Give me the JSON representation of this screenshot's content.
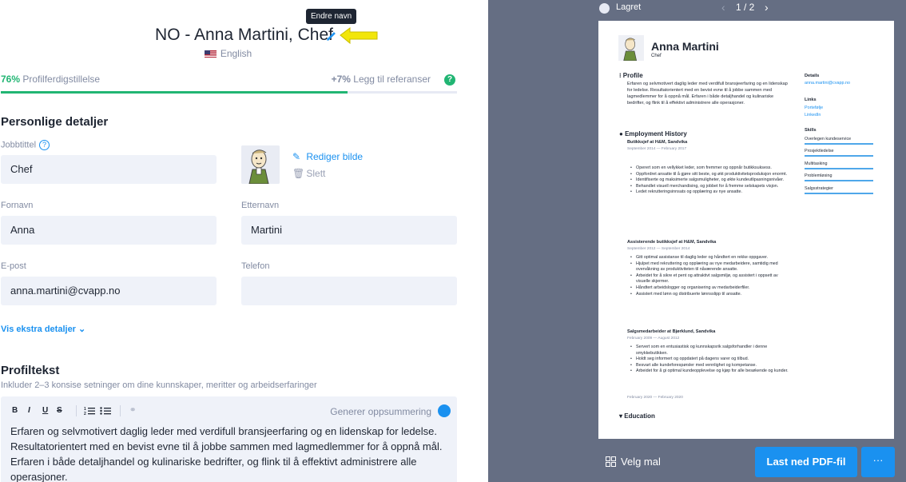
{
  "header": {
    "title": "NO - Anna Martini, Chef",
    "tooltip": "Endre navn",
    "language": "English"
  },
  "progress": {
    "percent_label": "76%",
    "label": "Profilferdigstillelse",
    "bonus": "+7%",
    "bonus_label": "Legg til referanser",
    "help": "?",
    "fill": 0.76
  },
  "personal": {
    "section_title": "Personlige detaljer",
    "job_title_label": "Jobbtittel",
    "job_title_value": "Chef",
    "edit_photo": "Rediger bilde",
    "delete_photo": "Slett",
    "first_name_label": "Fornavn",
    "first_name_value": "Anna",
    "last_name_label": "Etternavn",
    "last_name_value": "Martini",
    "email_label": "E-post",
    "email_value": "anna.martini@cvapp.no",
    "phone_label": "Telefon",
    "phone_value": "",
    "extra_details": "Vis ekstra detaljer"
  },
  "profile": {
    "section_title": "Profiltekst",
    "hint": "Inkluder 2–3 konsise setninger om dine kunnskaper, meritter og arbeidserfaringer",
    "toolbar": {
      "bold": "B",
      "italic": "I",
      "underline": "U",
      "strike": "S"
    },
    "generate": "Generer oppsummering",
    "text": " Erfaren og selvmotivert daglig leder med verdifull bransjeerfaring og en lidenskap for ledelse. Resultatorientert med en bevist evne til å jobbe sammen med lagmedlemmer for å oppnå mål. Erfaren i både detaljhandel og kulinariske bedrifter, og flink til å effektivt administrere alle operasjoner."
  },
  "preview": {
    "saved": "Lagret",
    "page_indicator": "1 / 2",
    "choose_template": "Velg mal",
    "download": "Last ned PDF-fil",
    "more": "···",
    "cv": {
      "name": "Anna Martini",
      "role": "Chef",
      "profile_h": "Profile",
      "profile_text": " Erfaren og selvmotivert daglig leder med verdifull bransjeerfaring og en lidenskap for ledelse.  Resultatorientert med en bevist evne til å jobbe sammen med lagmedlemmer for å oppnå mål.  Erfaren i både detaljhandel og kulinariske bedrifter, og flink til å effektivt administrere alle operasjoner.",
      "employment_h": "Employment History",
      "job1_title": "Butikksjef at H&M, Sandvika",
      "job1_date": "September 2014 — February 2017",
      "job1_items": [
        "Operert som en vellykket leder, som fremmer og oppnår butikksuksess.",
        "Oppfordret ansatte til å gjøre sitt beste, og økt produktivitetsproduksjon enormt.",
        "Identifiserte og maksimerte salgsmuligheter, og økte kundeutlipasningsnivåer.",
        "Behandlet visuell merchandising, og jobbet for å fremme selskapets visjon.",
        "Ledet rekrutteringsinnsats og opplæring av nye ansatte."
      ],
      "job2_title": "Assisterende butikksjef at H&M, Sandvika",
      "job2_date": "September 2012 — September 2014",
      "job2_items": [
        "Gitt optimal assistanse til daglig leder og håndtert en rekke oppgaver.",
        "Hjulpet med rekruttering og opplæring av nye medarbeidere, samtidig med  overvåkning av produktiviteten til nåværende ansatte.",
        "Arbeidet for å sikre et pent og attraktivt salgsmiljø, og assistert i oppsett av visuelle skjermer.",
        "Håndtert arbeidslogger og organisering av medarbeiderfiler.",
        "Assistert med lønn og distribuerte lønnsslipp til ansatte."
      ],
      "job3_title": "Salgsmedarbeider at Bjørklund, Sandvika",
      "job3_date": "February 2009 — August 2012",
      "job3_items": [
        "Servert som en entusiastisk og kunnskapsrik salgsforhandler i denne smykkebutikken.",
        "Holdt seg informert og oppdatert på dagens varer og tilbud.",
        "Besvart alle kundeforespørsler med vennlighet og kompetanse.",
        "Arbeidet for å gi optimal kundeopplevelse og kjøp for alle besøkende og kunder."
      ],
      "job4_date": "February 2020 — February 2020",
      "education_h": "Education",
      "details_h": "Details",
      "details_email": "anna.martini@cvapp.no",
      "links_h": "Links",
      "link1": "Portefølje",
      "link2": "LinkedIn",
      "skills_h": "Skills",
      "skills": [
        "Overlegen kundeservice",
        "Prosjektledelse",
        "Multitasking",
        "Problemløsing",
        "Salgsstrategier"
      ]
    }
  }
}
